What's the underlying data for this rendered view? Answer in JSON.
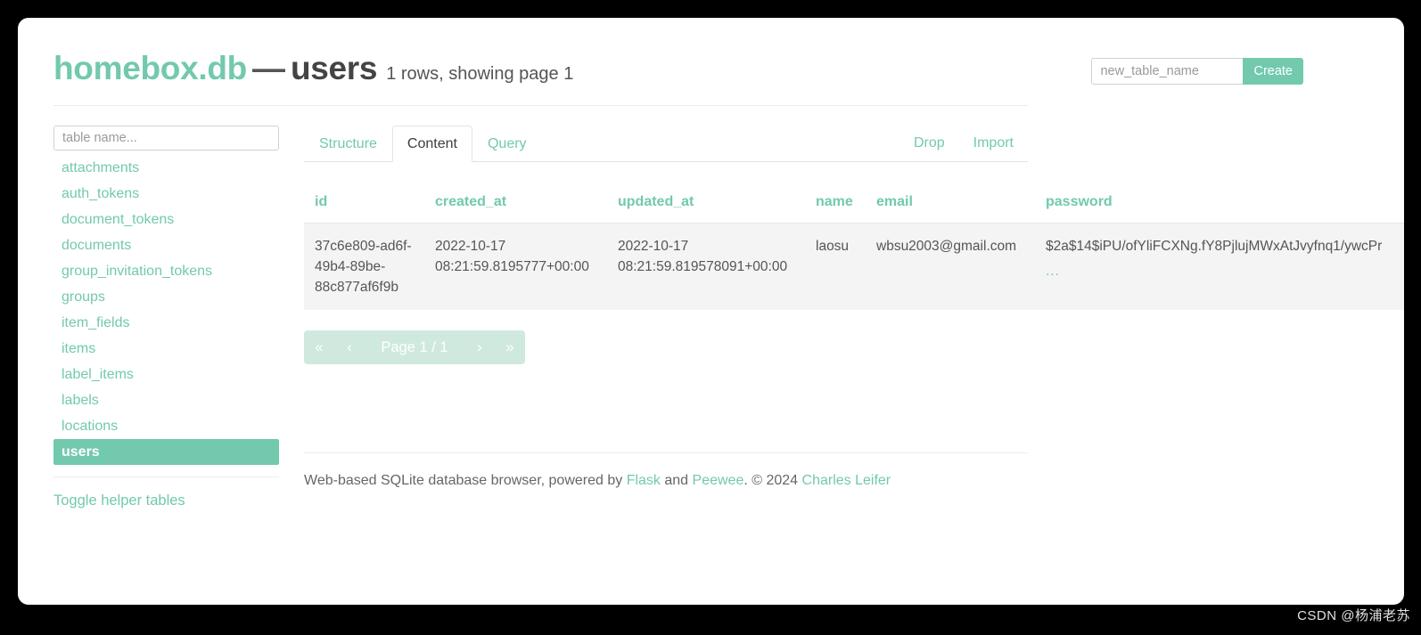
{
  "header": {
    "db_name": "homebox.db",
    "separator": "—",
    "table_name": "users",
    "row_summary": "1 rows, showing page 1",
    "create_table": {
      "placeholder": "new_table_name",
      "value": "",
      "button_label": "Create"
    }
  },
  "sidebar": {
    "filter": {
      "placeholder": "table name...",
      "value": ""
    },
    "tables": [
      {
        "label": "attachments",
        "active": false
      },
      {
        "label": "auth_tokens",
        "active": false
      },
      {
        "label": "document_tokens",
        "active": false
      },
      {
        "label": "documents",
        "active": false
      },
      {
        "label": "group_invitation_tokens",
        "active": false
      },
      {
        "label": "groups",
        "active": false
      },
      {
        "label": "item_fields",
        "active": false
      },
      {
        "label": "items",
        "active": false
      },
      {
        "label": "label_items",
        "active": false
      },
      {
        "label": "labels",
        "active": false
      },
      {
        "label": "locations",
        "active": false
      },
      {
        "label": "users",
        "active": true
      }
    ],
    "helper_toggle": "Toggle helper tables"
  },
  "tabs": [
    {
      "label": "Structure",
      "active": false
    },
    {
      "label": "Content",
      "active": true
    },
    {
      "label": "Query",
      "active": false
    }
  ],
  "tab_actions": [
    {
      "label": "Drop"
    },
    {
      "label": "Import"
    }
  ],
  "table": {
    "columns": [
      "id",
      "created_at",
      "updated_at",
      "name",
      "email",
      "password"
    ],
    "rows": [
      {
        "id": "37c6e809-ad6f-49b4-89be-88c877af6f9b",
        "created_at": "2022-10-17 08:21:59.8195777+00:00",
        "updated_at": "2022-10-17 08:21:59.819578091+00:00",
        "name": "laosu",
        "email": "wbsu2003@gmail.com",
        "password": "$2a$14$iPU/ofYliFCXNg.fY8PjlujMWxAtJvyfnq1/ywcPr",
        "password_more": "..."
      }
    ]
  },
  "pagination": {
    "first": "«",
    "prev": "‹",
    "label": "Page 1 / 1",
    "next": "›",
    "last": "»"
  },
  "footer": {
    "text_before": "Web-based SQLite database browser, powered by ",
    "link_flask": "Flask",
    "text_and": " and ",
    "link_peewee": "Peewee",
    "text_copyright": ". © 2024 ",
    "link_author": "Charles Leifer"
  },
  "watermark": "CSDN @杨浦老苏",
  "colors": {
    "accent": "#72c9ae",
    "accent_muted": "#cfe9df",
    "row_bg": "#f4f4f4",
    "text": "#555555",
    "page_bg": "#000000"
  }
}
